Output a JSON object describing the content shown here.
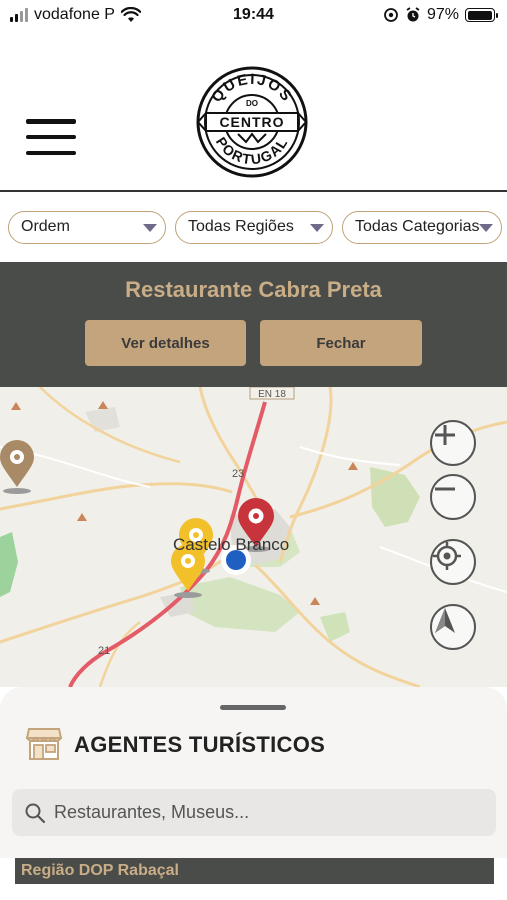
{
  "status_bar": {
    "carrier": "vodafone P",
    "time": "19:44",
    "battery": "97%",
    "battery_level": 0.97
  },
  "header": {
    "logo_text": [
      "QUEIJOS",
      "DO",
      "CENTRO",
      "PORTUGAL"
    ]
  },
  "filters": [
    {
      "label": "Ordem"
    },
    {
      "label": "Todas Regiões"
    },
    {
      "label": "Todas Categorias"
    }
  ],
  "info_panel": {
    "title": "Restaurante Cabra Preta",
    "details_label": "Ver detalhes",
    "close_label": "Fechar"
  },
  "map": {
    "city_label": "Castelo Branco",
    "road_labels": [
      "EN 18",
      "23",
      "21"
    ]
  },
  "sheet": {
    "title": "AGENTES TURÍSTICOS",
    "search_placeholder": "Restaurantes, Museus...",
    "region": "Região DOP Rabaçal"
  },
  "colors": {
    "accent_gold": "#c4a47c",
    "panel_dark": "#4a4c49",
    "pin_red": "#c8343c",
    "pin_yellow": "#f2c029",
    "pin_brown": "#a88a66",
    "location_blue": "#1f5fc2"
  },
  "icons": {
    "menu": "hamburger-menu-icon",
    "zoom_in": "plus-icon",
    "zoom_out": "minus-icon",
    "locate": "crosshair-icon",
    "compass": "north-arrow-icon",
    "category": "shop-icon",
    "search": "search-icon"
  }
}
